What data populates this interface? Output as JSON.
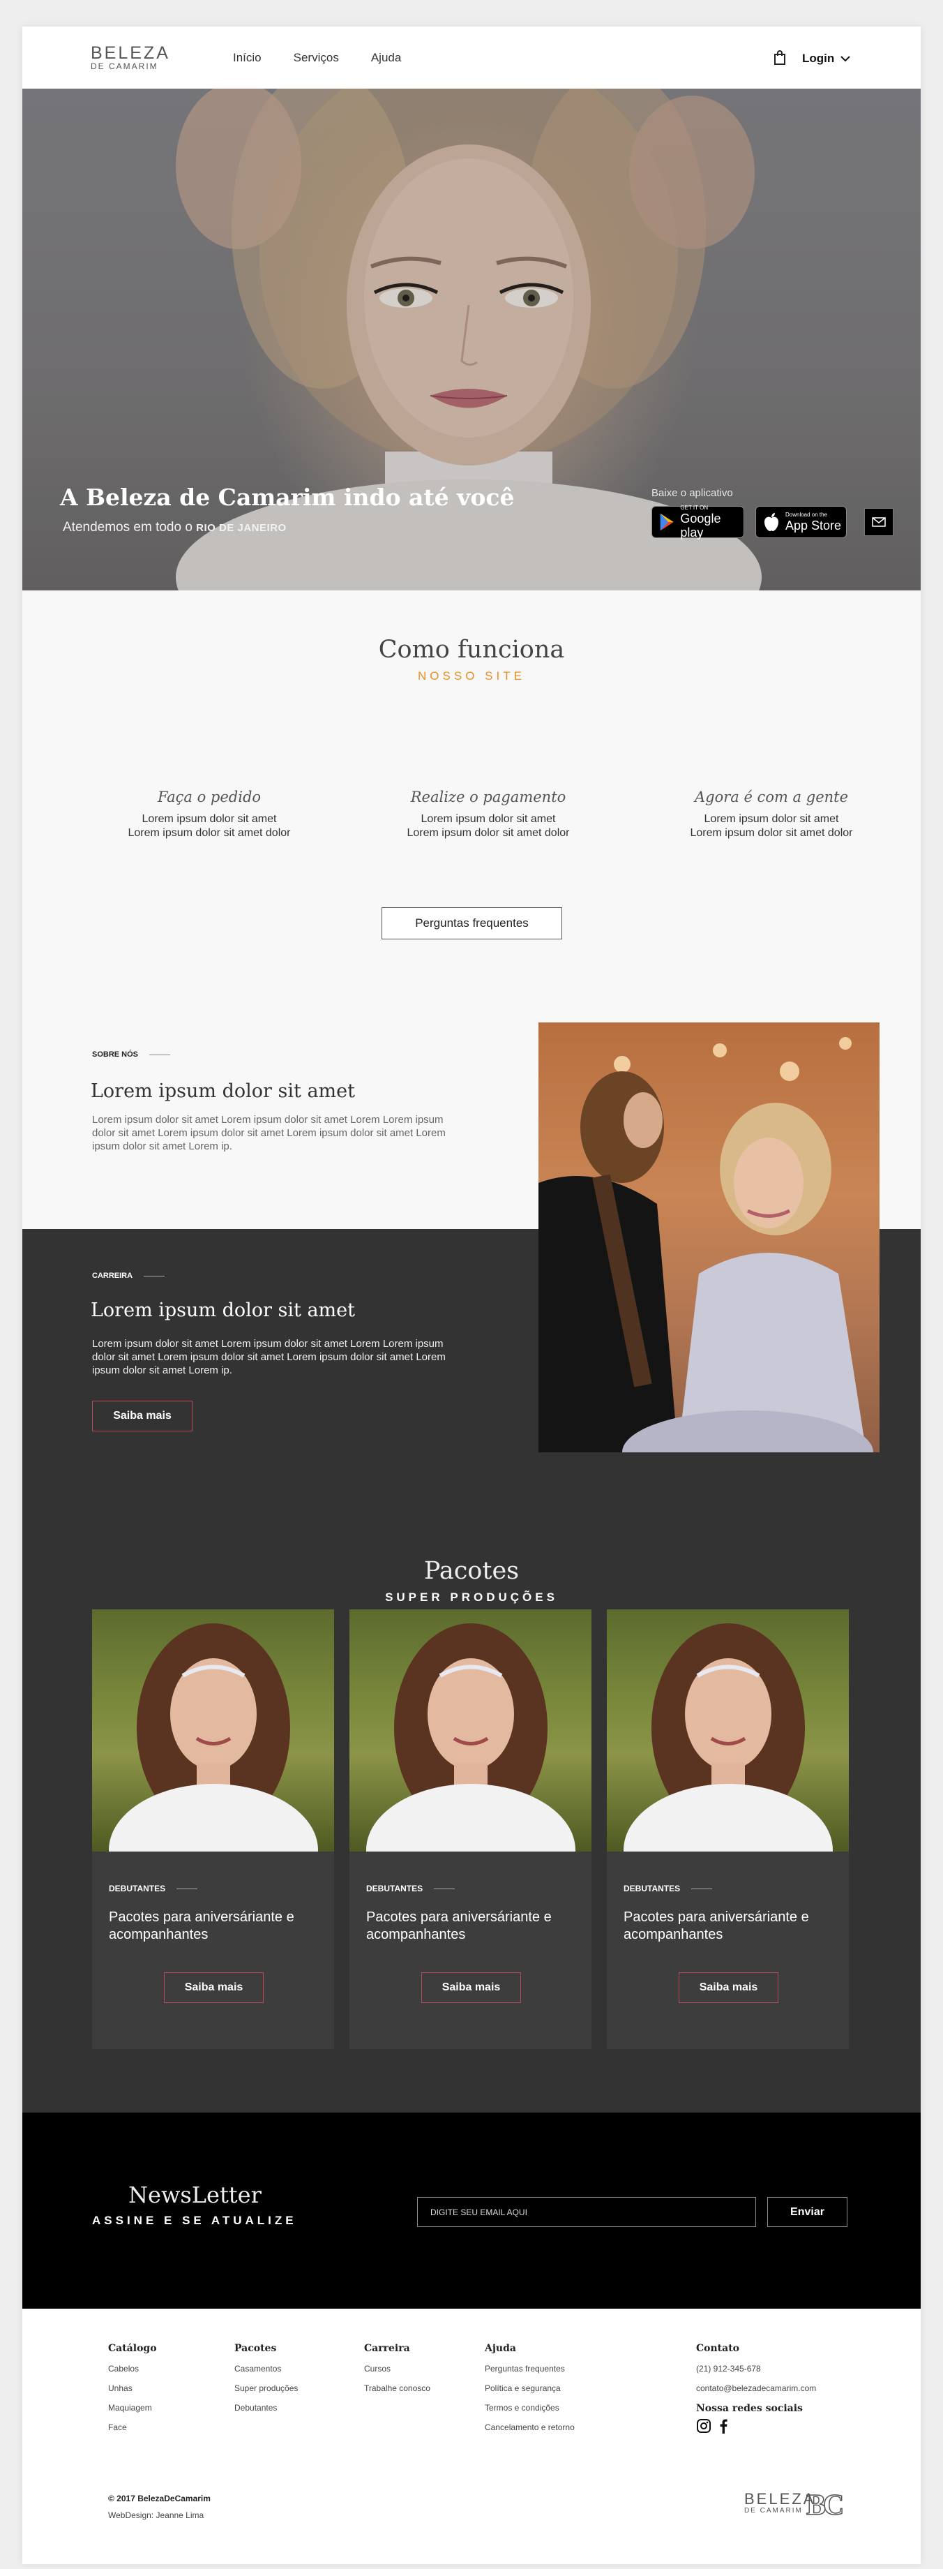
{
  "header": {
    "logo_line1": "BELEZA",
    "logo_line2": "DE CAMARIM",
    "nav": [
      "Início",
      "Serviços",
      "Ajuda"
    ],
    "login": "Login"
  },
  "hero": {
    "title": "A Beleza de Camarim indo até você",
    "subtitle_prefix": "Atendemos em todo o",
    "subtitle_bold": "RIO DE JANEIRO",
    "app_label": "Baixe o aplicativo",
    "google_small": "GET IT ON",
    "google_big": "Google play",
    "apple_small": "Download on the",
    "apple_big": "App Store"
  },
  "como": {
    "title": "Como funciona",
    "subtitle": "NOSSO SITE",
    "steps": [
      {
        "title": "Faça o pedido",
        "l1": "Lorem ipsum dolor sit amet",
        "l2": "Lorem ipsum dolor sit amet dolor"
      },
      {
        "title": "Realize o pagamento",
        "l1": "Lorem ipsum dolor sit amet",
        "l2": "Lorem ipsum dolor sit amet dolor"
      },
      {
        "title": "Agora é com a gente",
        "l1": "Lorem ipsum dolor sit amet",
        "l2": "Lorem ipsum dolor sit amet dolor"
      }
    ],
    "faq_button": "Perguntas frequentes"
  },
  "sobre": {
    "label": "SOBRE NÓS",
    "title": "Lorem ipsum dolor sit amet",
    "text": "Lorem ipsum dolor sit amet Lorem ipsum dolor sit amet Lorem Lorem ipsum dolor sit amet Lorem ipsum dolor sit amet Lorem ipsum dolor sit amet Lorem ipsum dolor sit amet Lorem ip."
  },
  "carreira": {
    "label": "CARREIRA",
    "title": "Lorem ipsum dolor sit amet",
    "text": "Lorem ipsum dolor sit amet Lorem ipsum dolor sit amet Lorem Lorem ipsum dolor sit amet Lorem ipsum dolor sit amet Lorem ipsum dolor sit amet Lorem ipsum dolor sit amet Lorem ip.",
    "button": "Saiba mais"
  },
  "pacotes": {
    "title": "Pacotes",
    "subtitle": "SUPER PRODUÇÕES",
    "cards": [
      {
        "label": "DEBUTANTES",
        "title": "Pacotes para aniversáriante e acompanhantes",
        "button": "Saiba mais"
      },
      {
        "label": "DEBUTANTES",
        "title": "Pacotes para aniversáriante e acompanhantes",
        "button": "Saiba mais"
      },
      {
        "label": "DEBUTANTES",
        "title": "Pacotes para aniversáriante e acompanhantes",
        "button": "Saiba mais"
      }
    ]
  },
  "newsletter": {
    "title": "NewsLetter",
    "subtitle": "ASSINE E SE ATUALIZE",
    "placeholder": "DIGITE SEU EMAIL AQUI",
    "button": "Enviar"
  },
  "footer": {
    "columns": [
      {
        "title": "Catálogo",
        "items": [
          "Cabelos",
          "Unhas",
          "Maquiagem",
          "Face"
        ]
      },
      {
        "title": "Pacotes",
        "items": [
          "Casamentos",
          "Super produções",
          "Debutantes"
        ]
      },
      {
        "title": "Carreira",
        "items": [
          "Cursos",
          "Trabalhe conosco"
        ]
      },
      {
        "title": "Ajuda",
        "items": [
          "Perguntas frequentes",
          "Política e segurança",
          "Termos e condições",
          "Cancelamento e retorno"
        ]
      }
    ],
    "contact_title": "Contato",
    "phone": "(21) 912-345-678",
    "email": "contato@belezadecamarim.com",
    "social_title": "Nossa redes sociais",
    "copyright": "© 2017 BelezaDeCamarim",
    "credit": "WebDesign: Jeanne Lima",
    "logo_line1": "BELEZA",
    "logo_line2": "DE CAMARIM",
    "logo_mark": "BC"
  }
}
